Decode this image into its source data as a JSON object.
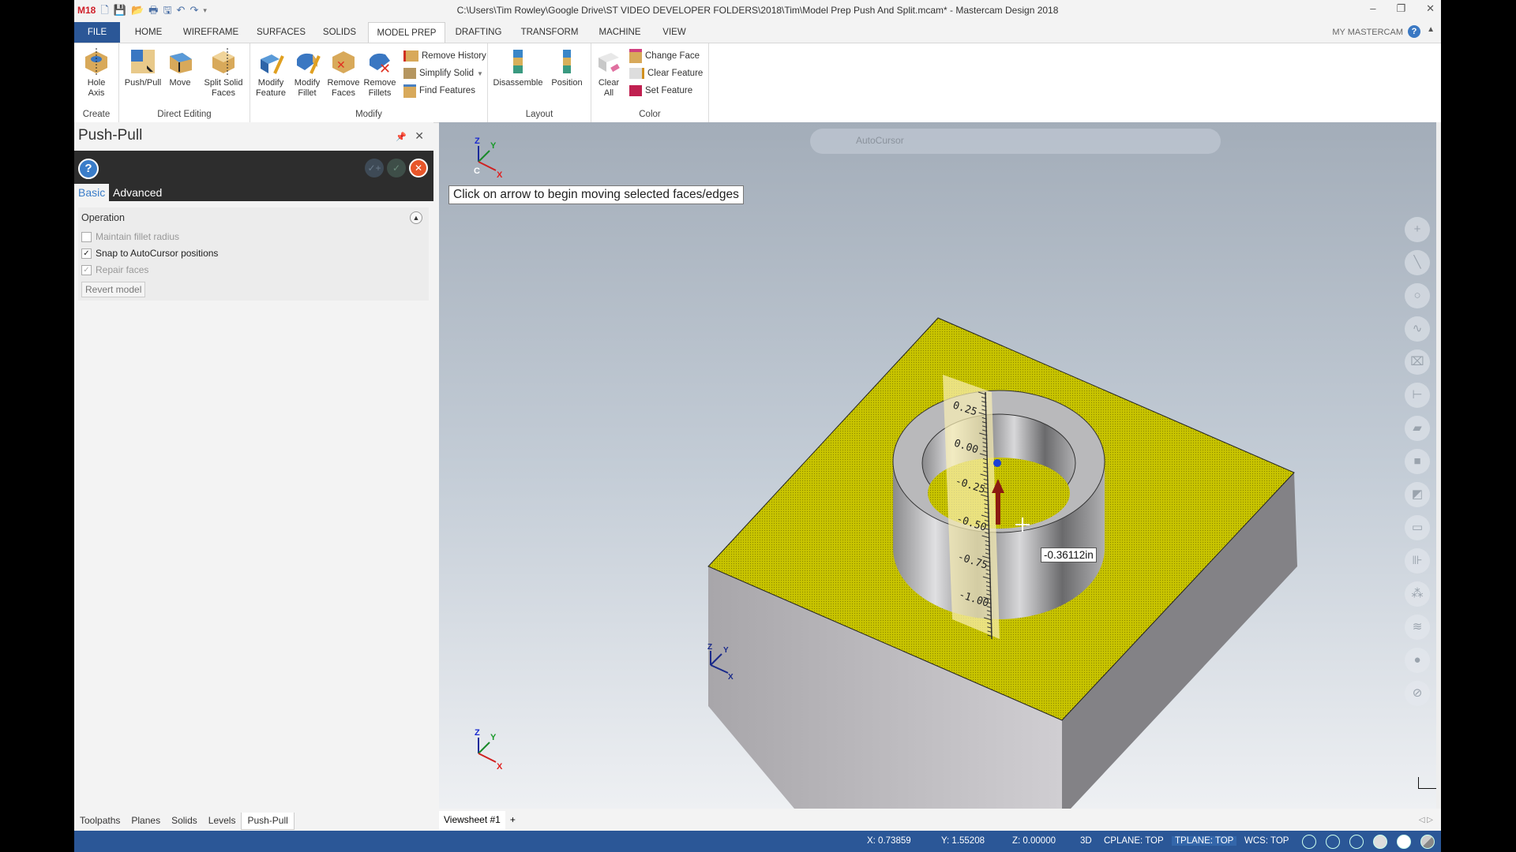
{
  "window": {
    "title": "C:\\Users\\Tim Rowley\\Google Drive\\ST VIDEO DEVELOPER FOLDERS\\2018\\Tim\\Model Prep Push And Split.mcam* - Mastercam Design 2018",
    "logo": "M18",
    "controls": {
      "minimize": "–",
      "restore": "❐",
      "close": "✕"
    }
  },
  "quick_access": [
    "new-file-icon",
    "save-icon",
    "open-icon",
    "print-icon",
    "save-as-icon",
    "undo-icon",
    "redo-icon",
    "customize-icon"
  ],
  "menu_tabs": [
    "FILE",
    "HOME",
    "WIREFRAME",
    "SURFACES",
    "SOLIDS",
    "MODEL PREP",
    "DRAFTING",
    "TRANSFORM",
    "MACHINE",
    "VIEW"
  ],
  "active_tab": "MODEL PREP",
  "my_mastercam": "MY MASTERCAM",
  "ribbon": {
    "groups": [
      {
        "label": "Create",
        "buttons": [
          {
            "label1": "Hole",
            "label2": "Axis"
          }
        ]
      },
      {
        "label": "Direct Editing",
        "buttons": [
          {
            "label1": "Push/Pull",
            "label2": ""
          },
          {
            "label1": "Move",
            "label2": ""
          },
          {
            "label1": "Split Solid",
            "label2": "Faces"
          }
        ]
      },
      {
        "label": "Modify",
        "buttons": [
          {
            "label1": "Modify",
            "label2": "Feature"
          },
          {
            "label1": "Modify",
            "label2": "Fillet"
          },
          {
            "label1": "Remove",
            "label2": "Faces"
          },
          {
            "label1": "Remove",
            "label2": "Fillets"
          }
        ],
        "small": [
          "Remove History",
          "Simplify Solid",
          "Find Features"
        ]
      },
      {
        "label": "Layout",
        "buttons": [
          {
            "label1": "Disassemble",
            "label2": ""
          },
          {
            "label1": "Position",
            "label2": ""
          }
        ]
      },
      {
        "label": "Color",
        "buttons": [
          {
            "label1": "Clear",
            "label2": "All"
          }
        ],
        "small": [
          "Change Face",
          "Clear Feature",
          "Set Feature"
        ]
      }
    ]
  },
  "panel": {
    "title": "Push-Pull",
    "tabs": [
      "Basic",
      "Advanced"
    ],
    "section": "Operation",
    "options": [
      {
        "label": "Maintain fillet radius",
        "checked": false,
        "enabled": false
      },
      {
        "label": "Snap to AutoCursor positions",
        "checked": true,
        "enabled": true
      },
      {
        "label": "Repair faces",
        "checked": true,
        "enabled": false
      }
    ],
    "revert": "Revert model"
  },
  "bottom_tabs": [
    "Toolpaths",
    "Planes",
    "Solids",
    "Levels",
    "Push-Pull"
  ],
  "active_bottom_tab": "Push-Pull",
  "viewsheet": {
    "tab": "Viewsheet #1",
    "add": "+"
  },
  "viewport": {
    "autocursor_label": "AutoCursor",
    "tooltip": "Click on arrow to begin moving selected faces/edges",
    "dimension": "-0.36112in",
    "ruler_ticks": [
      "0.25",
      "0.00",
      "-0.25",
      "-0.50",
      "-0.75",
      "-1.00"
    ],
    "scale": {
      "value": "0.3689 in",
      "unit": "Inch"
    },
    "gnomon_labels": {
      "x": "X",
      "y": "Y",
      "z": "Z",
      "c": "C"
    },
    "colors": {
      "top_face": "#c8c400",
      "body": "#8d8d8f",
      "ring": "#b9b9bb",
      "arrow": "#8b1a10",
      "handle": "#1c3fd6"
    }
  },
  "status": {
    "x": "X:  0.73859",
    "y": "Y:  1.55208",
    "z": "Z:  0.00000",
    "mode": "3D",
    "cplane": "CPLANE: TOP",
    "tplane": "TPLANE: TOP",
    "wcs": "WCS: TOP"
  }
}
